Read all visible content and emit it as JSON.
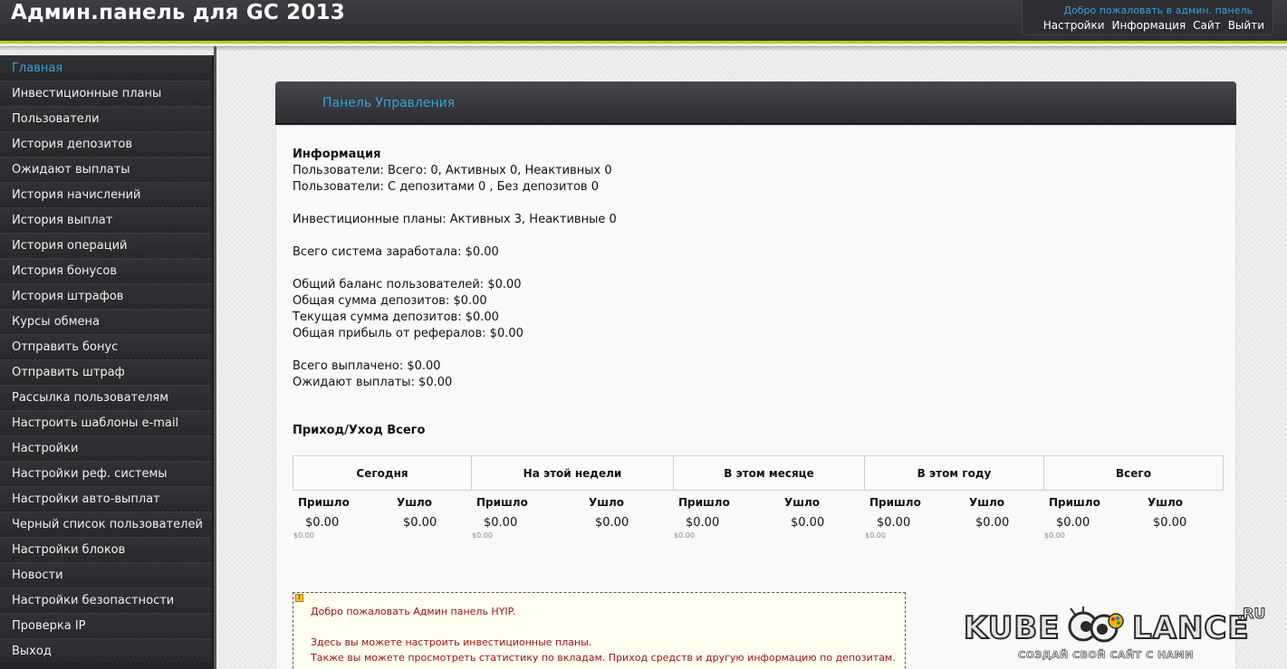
{
  "header": {
    "title": "Админ.панель для GC 2013",
    "welcome": "Добро пожаловать в админ. панель",
    "links": [
      "Настройки",
      "Информация",
      "Сайт",
      "Выйти"
    ]
  },
  "sidebar": {
    "items": [
      "Главная",
      "Инвестиционные планы",
      "Пользователи",
      "История депозитов",
      "Ожидают выплаты",
      "История начислений",
      "История выплат",
      "История операций",
      "История бонусов",
      "История штрафов",
      "Курсы обмена",
      "Отправить бонус",
      "Отправить штраф",
      "Рассылка пользователям",
      "Настроить шаблоны e-mail",
      "Настройки",
      "Настройки реф. системы",
      "Настройки авто-выплат",
      "Черный список пользователей",
      "Настройки блоков",
      "Новости",
      "Настройки безопастности",
      "Проверка IP",
      "Выход"
    ]
  },
  "panel": {
    "title": "Панель Управления",
    "info_heading": "Информация",
    "info_lines": [
      "Пользователи: Всего: 0, Активных 0, Неактивных 0",
      "Пользователи: С депозитами 0 , Без депозитов 0",
      "",
      "Инвестиционные планы: Активных 3, Неактивные 0",
      "",
      "Всего система заработала: $0.00",
      "",
      "Общий баланс пользователей: $0.00",
      "Общая сумма депозитов: $0.00",
      "Текущая сумма депозитов: $0.00",
      "Общая прибыль от рефералов: $0.00",
      "",
      "Всего выплачено: $0.00",
      "Ожидают выплаты: $0.00"
    ],
    "io_heading": "Приход/Уход Всего",
    "periods": [
      "Сегодня",
      "На этой недели",
      "В этом месяце",
      "В этом году",
      "Всего"
    ],
    "in_label": "Пришло",
    "out_label": "Ушло",
    "values": [
      {
        "in": "$0.00",
        "out": "$0.00",
        "net": "$0.00"
      },
      {
        "in": "$0.00",
        "out": "$0.00",
        "net": "$0.00"
      },
      {
        "in": "$0.00",
        "out": "$0.00",
        "net": "$0.00"
      },
      {
        "in": "$0.00",
        "out": "$0.00",
        "net": "$0.00"
      },
      {
        "in": "$0.00",
        "out": "$0.00",
        "net": "$0.00"
      }
    ]
  },
  "notice": {
    "line1": "Добро пожаловать Админ панель HYIP.",
    "line2": "Здесь вы можете настроить инвестиционные планы.",
    "line3": "Также вы можете просмотреть статистику по вкладам. Приход средств и другую информацию по депозитам."
  },
  "watermark": {
    "left": "KUBE",
    "right": "LANCE",
    "suffix": ".RU",
    "tagline": "СОЗДАЙ СВОЙ САЙТ С НАМИ"
  }
}
